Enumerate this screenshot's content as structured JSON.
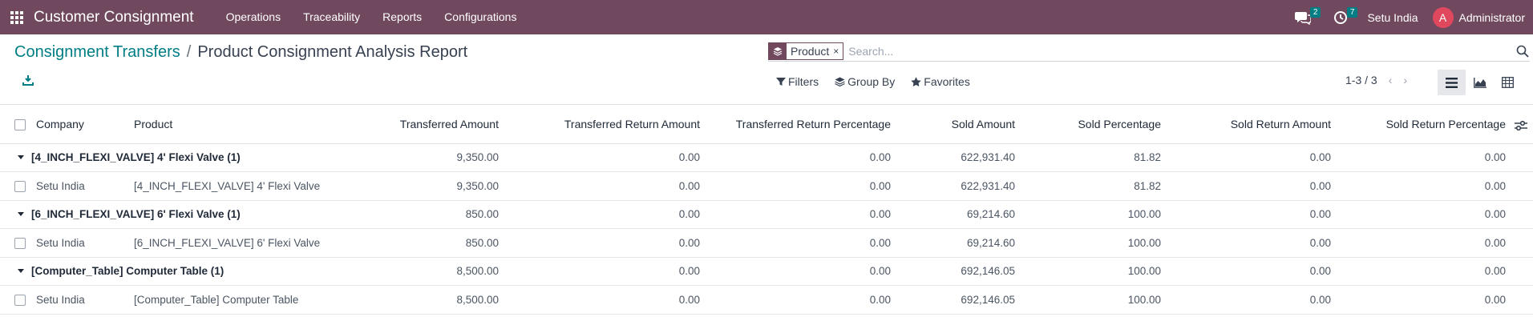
{
  "navbar": {
    "app_title": "Customer Consignment",
    "menu": [
      "Operations",
      "Traceability",
      "Reports",
      "Configurations"
    ],
    "messages_count": "2",
    "activities_count": "7",
    "company": "Setu India",
    "user_initial": "A",
    "user_name": "Administrator",
    "bg_color": "#71495f"
  },
  "breadcrumb": {
    "parent": "Consignment Transfers",
    "separator": "/",
    "current": "Product Consignment Analysis Report"
  },
  "search": {
    "facet_label": "Product",
    "facet_remove": "×",
    "placeholder": "Search..."
  },
  "filters": {
    "filters_label": "Filters",
    "group_by_label": "Group By",
    "favorites_label": "Favorites"
  },
  "pager": {
    "value": "1-3 / 3",
    "prev": "‹",
    "next": "›"
  },
  "icons": {
    "download": "download-icon",
    "list_view": "list-view-icon",
    "graph_view": "graph-view-icon",
    "pivot_view": "pivot-view-icon",
    "optional_columns": "optional-columns-icon"
  },
  "table": {
    "columns": {
      "company": "Company",
      "product": "Product",
      "transferred_amount": "Transferred Amount",
      "transferred_return_amount": "Transferred Return Amount",
      "transferred_return_percentage": "Transferred Return Percentage",
      "sold_amount": "Sold Amount",
      "sold_percentage": "Sold Percentage",
      "sold_return_amount": "Sold Return Amount",
      "sold_return_percentage": "Sold Return Percentage"
    },
    "groups": [
      {
        "label": "[4_INCH_FLEXI_VALVE] 4' Flexi Valve (1)",
        "transferred_amount": "9,350.00",
        "transferred_return_amount": "0.00",
        "transferred_return_percentage": "0.00",
        "sold_amount": "622,931.40",
        "sold_percentage": "81.82",
        "sold_return_amount": "0.00",
        "sold_return_percentage": "0.00",
        "row": {
          "company": "Setu India",
          "product": "[4_INCH_FLEXI_VALVE] 4' Flexi Valve",
          "transferred_amount": "9,350.00",
          "transferred_return_amount": "0.00",
          "transferred_return_percentage": "0.00",
          "sold_amount": "622,931.40",
          "sold_percentage": "81.82",
          "sold_return_amount": "0.00",
          "sold_return_percentage": "0.00"
        }
      },
      {
        "label": "[6_INCH_FLEXI_VALVE] 6' Flexi Valve (1)",
        "transferred_amount": "850.00",
        "transferred_return_amount": "0.00",
        "transferred_return_percentage": "0.00",
        "sold_amount": "69,214.60",
        "sold_percentage": "100.00",
        "sold_return_amount": "0.00",
        "sold_return_percentage": "0.00",
        "row": {
          "company": "Setu India",
          "product": "[6_INCH_FLEXI_VALVE] 6' Flexi Valve",
          "transferred_amount": "850.00",
          "transferred_return_amount": "0.00",
          "transferred_return_percentage": "0.00",
          "sold_amount": "69,214.60",
          "sold_percentage": "100.00",
          "sold_return_amount": "0.00",
          "sold_return_percentage": "0.00"
        }
      },
      {
        "label": "[Computer_Table] Computer Table (1)",
        "transferred_amount": "8,500.00",
        "transferred_return_amount": "0.00",
        "transferred_return_percentage": "0.00",
        "sold_amount": "692,146.05",
        "sold_percentage": "100.00",
        "sold_return_amount": "0.00",
        "sold_return_percentage": "0.00",
        "row": {
          "company": "Setu India",
          "product": "[Computer_Table] Computer Table",
          "transferred_amount": "8,500.00",
          "transferred_return_amount": "0.00",
          "transferred_return_percentage": "0.00",
          "sold_amount": "692,146.05",
          "sold_percentage": "100.00",
          "sold_return_amount": "0.00",
          "sold_return_percentage": "0.00"
        }
      }
    ]
  }
}
